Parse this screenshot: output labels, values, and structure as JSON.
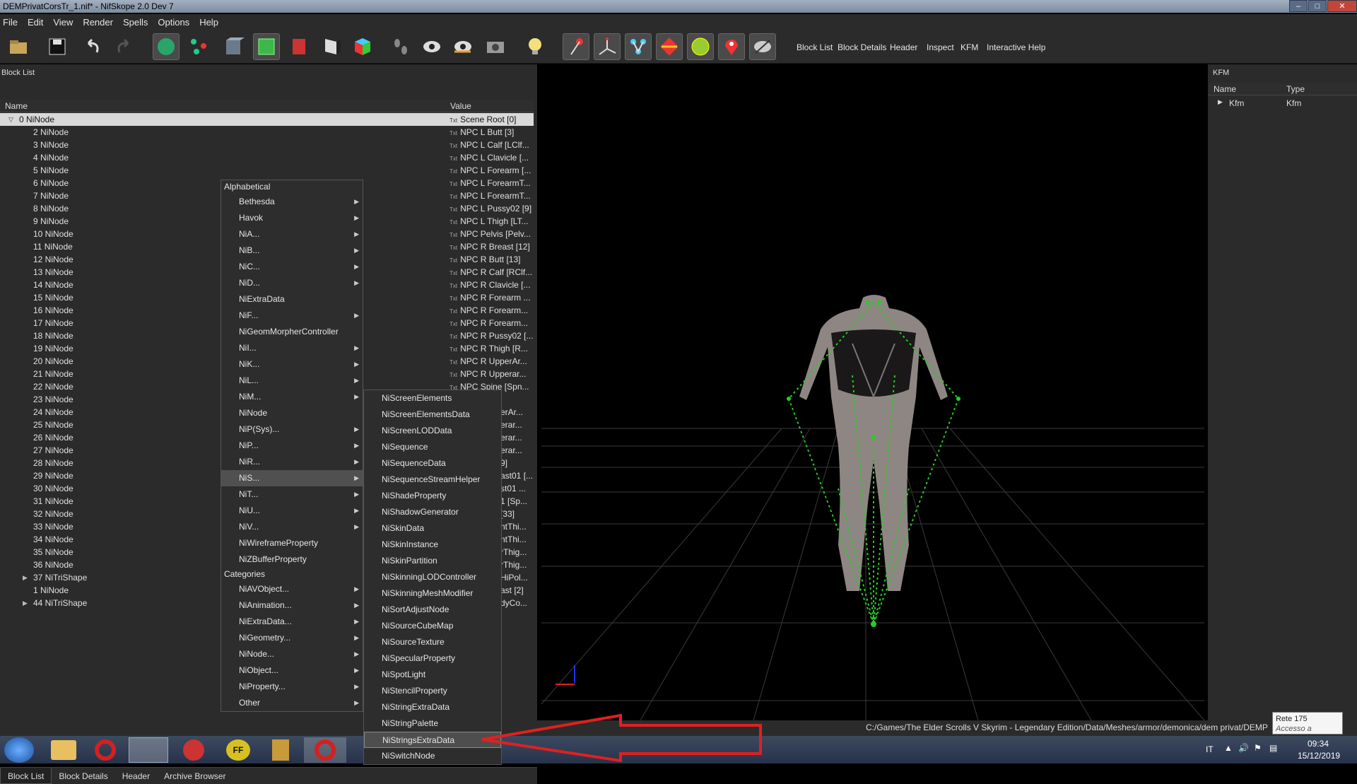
{
  "window": {
    "title": "DEMPrivatCorsTr_1.nif* - NifSkope 2.0 Dev 7",
    "min": "–",
    "max": "□",
    "close": "✕"
  },
  "menu": [
    "File",
    "Edit",
    "View",
    "Render",
    "Spells",
    "Options",
    "Help"
  ],
  "toolbar": {
    "labels": [
      "Block List",
      "Block Details",
      "Header",
      "Inspect",
      "KFM",
      "Interactive Help"
    ]
  },
  "block_list": {
    "title": "Block List",
    "columns": {
      "name": "Name",
      "value": "Value"
    },
    "rows": [
      {
        "name": "0 NiNode",
        "value": "Scene Root [0]"
      },
      {
        "name": "2 NiNode",
        "value": "NPC L Butt [3]"
      },
      {
        "name": "3 NiNode",
        "value": "NPC L Calf [LClf..."
      },
      {
        "name": "4 NiNode",
        "value": "NPC L Clavicle [..."
      },
      {
        "name": "5 NiNode",
        "value": "NPC L Forearm [..."
      },
      {
        "name": "6 NiNode",
        "value": "NPC L ForearmT..."
      },
      {
        "name": "7 NiNode",
        "value": "NPC L ForearmT..."
      },
      {
        "name": "8 NiNode",
        "value": "NPC L Pussy02 [9]"
      },
      {
        "name": "9 NiNode",
        "value": "NPC L Thigh [LT..."
      },
      {
        "name": "10 NiNode",
        "value": "NPC Pelvis [Pelv..."
      },
      {
        "name": "11 NiNode",
        "value": "NPC R Breast [12]"
      },
      {
        "name": "12 NiNode",
        "value": "NPC R Butt [13]"
      },
      {
        "name": "13 NiNode",
        "value": "NPC R Calf [RClf..."
      },
      {
        "name": "14 NiNode",
        "value": "NPC R Clavicle [..."
      },
      {
        "name": "15 NiNode",
        "value": "NPC R Forearm ..."
      },
      {
        "name": "16 NiNode",
        "value": "NPC R Forearm..."
      },
      {
        "name": "17 NiNode",
        "value": "NPC R Forearm..."
      },
      {
        "name": "18 NiNode",
        "value": "NPC R Pussy02 [..."
      },
      {
        "name": "19 NiNode",
        "value": "NPC R Thigh [R..."
      },
      {
        "name": "20 NiNode",
        "value": "NPC R UpperAr..."
      },
      {
        "name": "21 NiNode",
        "value": "NPC R Upperar..."
      },
      {
        "name": "22 NiNode",
        "value": "NPC Spine [Spn..."
      },
      {
        "name": "23 NiNode",
        "value": "2 [Sp..."
      },
      {
        "name": "24 NiNode",
        "value": "erAr..."
      },
      {
        "name": "25 NiNode",
        "value": "erar..."
      },
      {
        "name": "26 NiNode",
        "value": "erar..."
      },
      {
        "name": "27 NiNode",
        "value": "erar..."
      },
      {
        "name": "28 NiNode",
        "value": "9]"
      },
      {
        "name": "29 NiNode",
        "value": "ast01 [..."
      },
      {
        "name": "30 NiNode",
        "value": "st01 ..."
      },
      {
        "name": "31 NiNode",
        "value": "1 [Sp..."
      },
      {
        "name": "32 NiNode",
        "value": "[33]"
      },
      {
        "name": "33 NiNode",
        "value": "ntThi..."
      },
      {
        "name": "34 NiNode",
        "value": "ntThi..."
      },
      {
        "name": "35 NiNode",
        "value": "rThig..."
      },
      {
        "name": "36 NiNode",
        "value": "rThig..."
      },
      {
        "name": "37 NiTriShape",
        "value": "HiPol..."
      },
      {
        "name": "1 NiNode",
        "value": "ast [2]"
      },
      {
        "name": "44 NiTriShape",
        "value": "dyCo..."
      }
    ]
  },
  "context_menu": {
    "items": [
      {
        "label": "Alphabetical",
        "sect": true
      },
      {
        "label": "Bethesda",
        "arrow": true
      },
      {
        "label": "Havok",
        "arrow": true
      },
      {
        "label": "NiA...",
        "arrow": true
      },
      {
        "label": "NiB...",
        "arrow": true
      },
      {
        "label": "NiC...",
        "arrow": true
      },
      {
        "label": "NiD...",
        "arrow": true
      },
      {
        "label": "NiExtraData"
      },
      {
        "label": "NiF...",
        "arrow": true
      },
      {
        "label": "NiGeomMorpherController"
      },
      {
        "label": "NiI...",
        "arrow": true
      },
      {
        "label": "NiK...",
        "arrow": true
      },
      {
        "label": "NiL...",
        "arrow": true
      },
      {
        "label": "NiM...",
        "arrow": true
      },
      {
        "label": "NiNode"
      },
      {
        "label": "NiP(Sys)...",
        "arrow": true
      },
      {
        "label": "NiP...",
        "arrow": true
      },
      {
        "label": "NiR...",
        "arrow": true
      },
      {
        "label": "NiS...",
        "arrow": true,
        "hl": true
      },
      {
        "label": "NiT...",
        "arrow": true
      },
      {
        "label": "NiU...",
        "arrow": true
      },
      {
        "label": "NiV...",
        "arrow": true
      },
      {
        "label": "NiWireframeProperty"
      },
      {
        "label": "NiZBufferProperty"
      },
      {
        "label": "Categories",
        "sect": true
      },
      {
        "label": "NiAVObject...",
        "arrow": true
      },
      {
        "label": "NiAnimation...",
        "arrow": true
      },
      {
        "label": "NiExtraData...",
        "arrow": true
      },
      {
        "label": "NiGeometry...",
        "arrow": true
      },
      {
        "label": "NiNode...",
        "arrow": true
      },
      {
        "label": "NiObject...",
        "arrow": true
      },
      {
        "label": "NiProperty...",
        "arrow": true
      },
      {
        "label": "Other",
        "arrow": true
      }
    ]
  },
  "submenu": {
    "items": [
      {
        "label": "NiScreenElements"
      },
      {
        "label": "NiScreenElementsData"
      },
      {
        "label": "NiScreenLODData"
      },
      {
        "label": "NiSequence"
      },
      {
        "label": "NiSequenceData"
      },
      {
        "label": "NiSequenceStreamHelper"
      },
      {
        "label": "NiShadeProperty"
      },
      {
        "label": "NiShadowGenerator"
      },
      {
        "label": "NiSkinData"
      },
      {
        "label": "NiSkinInstance"
      },
      {
        "label": "NiSkinPartition"
      },
      {
        "label": "NiSkinningLODController"
      },
      {
        "label": "NiSkinningMeshModifier"
      },
      {
        "label": "NiSortAdjustNode"
      },
      {
        "label": "NiSourceCubeMap"
      },
      {
        "label": "NiSourceTexture"
      },
      {
        "label": "NiSpecularProperty"
      },
      {
        "label": "NiSpotLight"
      },
      {
        "label": "NiStencilProperty"
      },
      {
        "label": "NiStringExtraData"
      },
      {
        "label": "NiStringPalette"
      },
      {
        "label": "NiStringsExtraData",
        "hl": true
      },
      {
        "label": "NiSwitchNode"
      }
    ]
  },
  "bottom_tabs": [
    "Block List",
    "Block Details",
    "Header",
    "Archive Browser"
  ],
  "kfm": {
    "title": "KFM",
    "columns": {
      "name": "Name",
      "type": "Type"
    },
    "row": {
      "name": "Kfm",
      "type": "Kfm"
    }
  },
  "status": {
    "path": "C:/Games/The Elder Scrolls V Skyrim - Legendary Edition/Data/Meshes/armor/demonica/dem privat/DEMP",
    "net_title": "Rete 175",
    "net_sub": "Accesso a Internet"
  },
  "taskbar": {
    "lang": "IT",
    "time": "09:34",
    "date": "15/12/2019"
  },
  "colors": {
    "bone": "#22d022",
    "arrow": "#e02020"
  }
}
